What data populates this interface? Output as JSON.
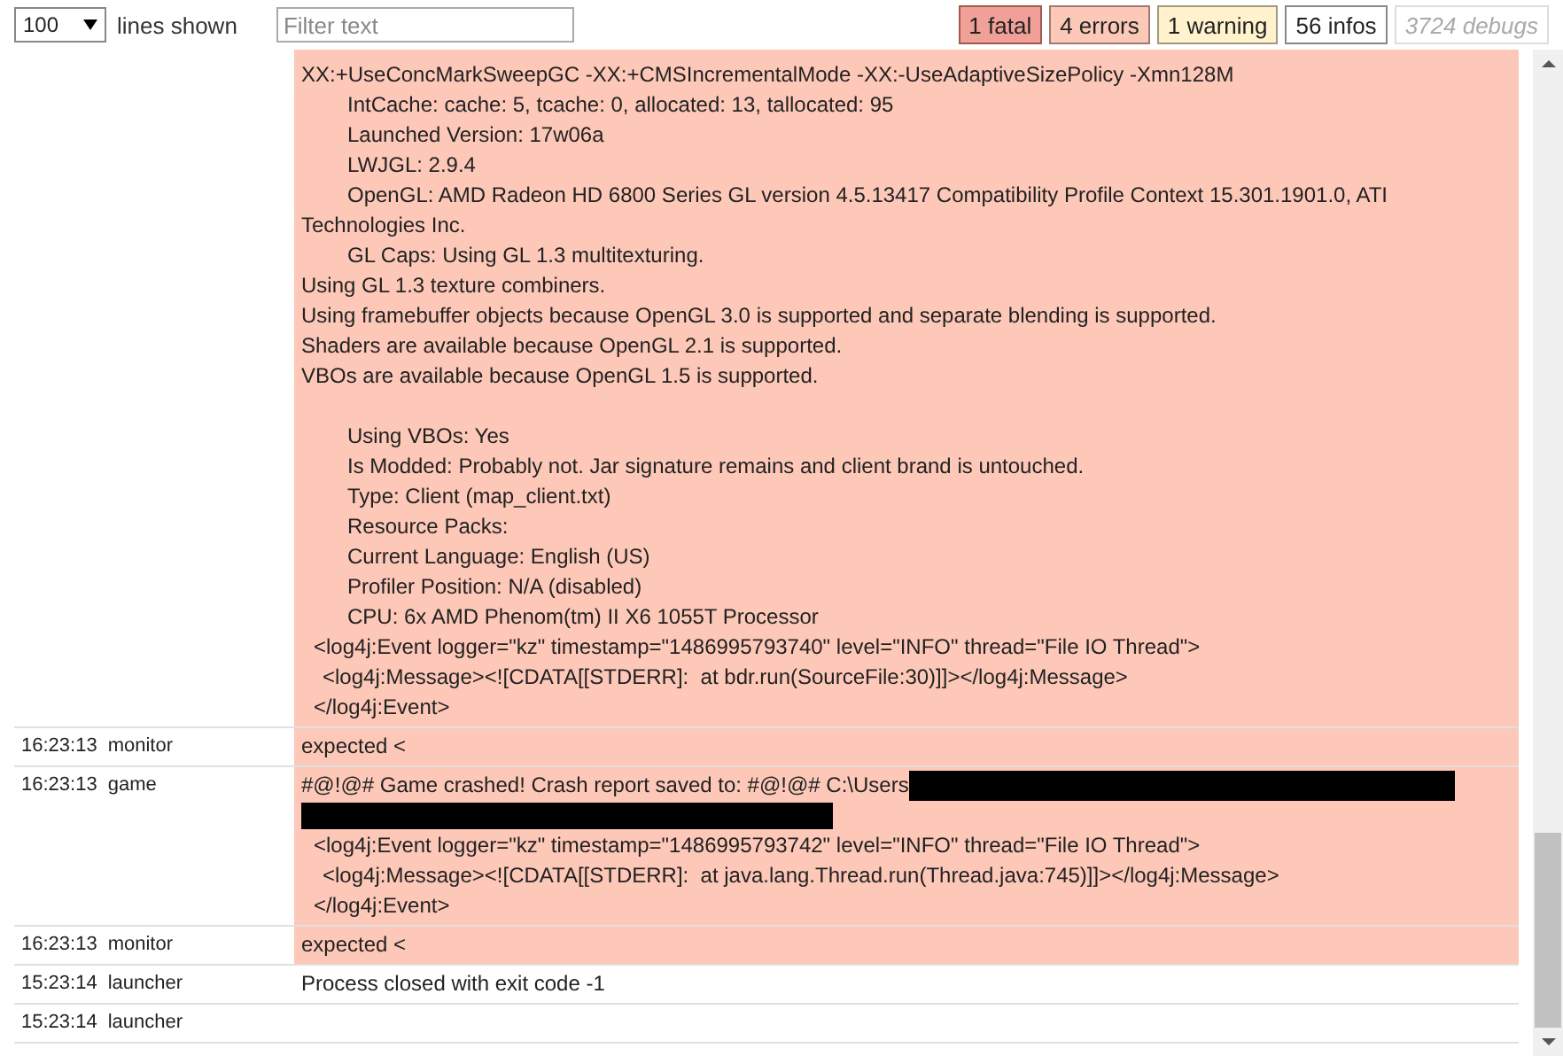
{
  "toolbar": {
    "line_count": "100",
    "line_count_label": "lines shown",
    "filter": {
      "placeholder": "Filter text"
    },
    "badges": [
      {
        "kind": "fatal",
        "label": "1 fatal",
        "on": true
      },
      {
        "kind": "error",
        "label": "4 errors",
        "on": true
      },
      {
        "kind": "warning",
        "label": "1 warning",
        "on": true
      },
      {
        "kind": "info",
        "label": "56 infos",
        "on": true
      },
      {
        "kind": "debug",
        "label": "3724 debugs",
        "on": false
      }
    ]
  },
  "rows": [
    {
      "highlighted": true,
      "lines": [
        {
          "kind": "plain",
          "text": "XX:+UseConcMarkSweepGC -XX:+CMSIncrementalMode -XX:-UseAdaptiveSizePolicy -Xmn128M"
        },
        {
          "kind": "indented",
          "text": "IntCache: cache: 5, tcache: 0, allocated: 13, tallocated: 95"
        },
        {
          "kind": "indented",
          "text": "Launched Version: 17w06a"
        },
        {
          "kind": "indented",
          "text": "LWJGL: 2.9.4"
        },
        {
          "kind": "indented",
          "text": "OpenGL: AMD Radeon HD 6800 Series GL version 4.5.13417 Compatibility Profile Context 15.301.1901.0, ATI"
        },
        {
          "kind": "plain",
          "text": "Technologies Inc."
        },
        {
          "kind": "indented",
          "text": "GL Caps: Using GL 1.3 multitexturing."
        },
        {
          "kind": "plain",
          "text": "Using GL 1.3 texture combiners."
        },
        {
          "kind": "plain",
          "text": "Using framebuffer objects because OpenGL 3.0 is supported and separate blending is supported."
        },
        {
          "kind": "plain",
          "text": "Shaders are available because OpenGL 2.1 is supported."
        },
        {
          "kind": "plain",
          "text": "VBOs are available because OpenGL 1.5 is supported."
        },
        {
          "kind": "blank"
        },
        {
          "kind": "indented",
          "text": "Using VBOs: Yes"
        },
        {
          "kind": "indented",
          "text": "Is Modded: Probably not. Jar signature remains and client brand is untouched."
        },
        {
          "kind": "indented",
          "text": "Type: Client (map_client.txt)"
        },
        {
          "kind": "indented",
          "text": "Resource Packs:"
        },
        {
          "kind": "indented",
          "text": "Current Language: English (US)"
        },
        {
          "kind": "indented",
          "text": "Profiler Position: N/A (disabled)"
        },
        {
          "kind": "indented",
          "text": "CPU: 6x AMD Phenom(tm) II X6 1055T Processor"
        },
        {
          "kind": "xml",
          "text": "<log4j:Event logger=\"kz\" timestamp=\"1486995793740\" level=\"INFO\" thread=\"File IO Thread\">"
        },
        {
          "kind": "xml-nested",
          "text": "<log4j:Message><![CDATA[[STDERR]:  at bdr.run(SourceFile:30)]]></log4j:Message>"
        },
        {
          "kind": "xml",
          "text": "</log4j:Event>"
        }
      ]
    },
    {
      "time": "16:23:13",
      "source": "monitor",
      "highlighted": true,
      "lines": [
        {
          "kind": "plain",
          "text": "expected <"
        }
      ]
    },
    {
      "time": "16:23:13",
      "source": "game",
      "highlighted": true,
      "lines": [
        {
          "kind": "text-redacted",
          "text": "#@!@# Game crashed! Crash report saved to: #@!@# C:\\Users"
        },
        {
          "kind": "redacted"
        },
        {
          "kind": "xml",
          "text": "<log4j:Event logger=\"kz\" timestamp=\"1486995793742\" level=\"INFO\" thread=\"File IO Thread\">"
        },
        {
          "kind": "xml-nested",
          "text": "<log4j:Message><![CDATA[[STDERR]:  at java.lang.Thread.run(Thread.java:745)]]></log4j:Message>"
        },
        {
          "kind": "xml",
          "text": "</log4j:Event>"
        }
      ]
    },
    {
      "time": "16:23:13",
      "source": "monitor",
      "highlighted": true,
      "lines": [
        {
          "kind": "plain",
          "text": "expected <"
        }
      ]
    },
    {
      "time": "15:23:14",
      "source": "launcher",
      "highlighted": false,
      "lines": [
        {
          "kind": "plain",
          "text": "Process closed with exit code -1"
        }
      ]
    },
    {
      "time": "15:23:14",
      "source": "launcher",
      "highlighted": false,
      "lines": []
    }
  ]
}
